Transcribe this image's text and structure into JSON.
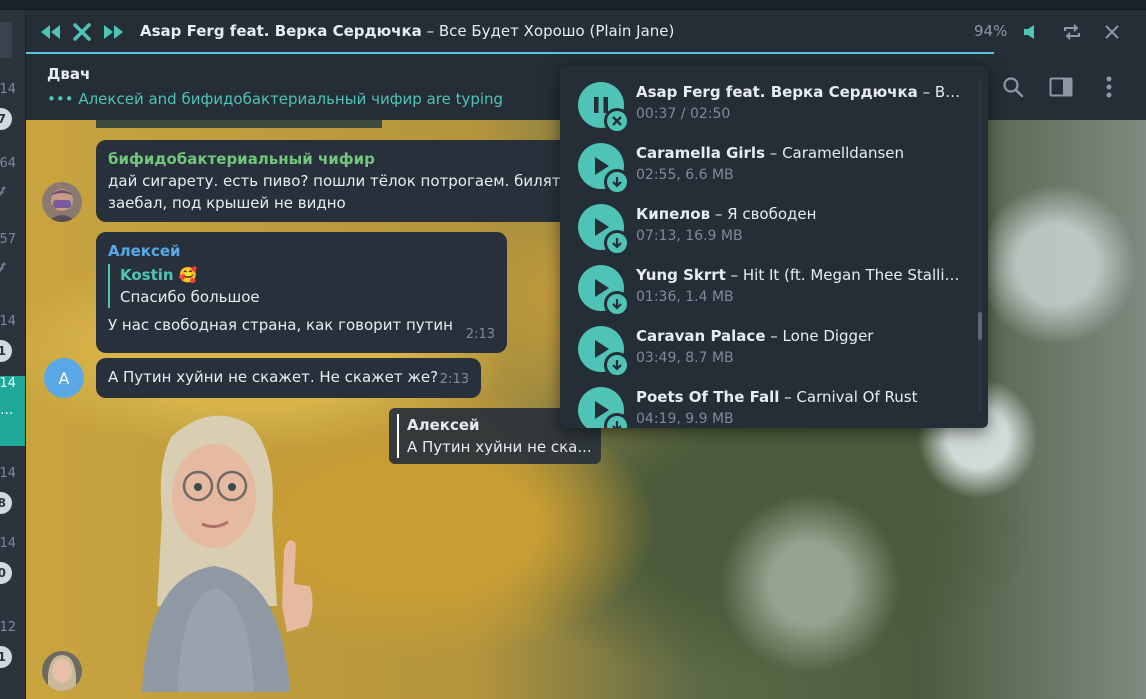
{
  "player": {
    "artist": "Asap Ferg feat. Верка Сердючка",
    "separator": " – ",
    "track": "Все Будет Хорошо (Plain Jane)",
    "volume": "94%",
    "progress_fraction": 0.927
  },
  "chat": {
    "name": "Двач",
    "typing_dots": "•••",
    "typing_text": "Алексей and бифидобактериальный чифир are typing"
  },
  "sidebar": {
    "rows": [
      {
        "time": "14",
        "badge": "7"
      },
      {
        "time": "64",
        "badge": ""
      },
      {
        "time": "57",
        "badge": ""
      },
      {
        "time": "14",
        "badge": "1"
      },
      {
        "time": "14",
        "badge": "...",
        "active": true
      },
      {
        "time": "14",
        "badge": "8"
      },
      {
        "time": "14",
        "badge": "0"
      },
      {
        "time": "12",
        "badge": "1"
      }
    ]
  },
  "messages": [
    {
      "sender": "бифидобактериальный чифир",
      "line1": "дай сигарету. есть пиво? пошли тёлок потрогаем. билять",
      "line2": "заебал, под крышей не видно"
    },
    {
      "sender": "Алексей",
      "quote_name": "Kostin 🥰",
      "quote_text": "Спасибо большое",
      "text": "У нас свободная страна, как говорит путин",
      "time": "2:13"
    },
    {
      "avatar_letter": "A",
      "text": "А Путин хуйни не скажет. Не скажет же?",
      "time": "2:13"
    }
  ],
  "reply_preview": {
    "name": "Алексей",
    "text": "А Путин хуйни не ска..."
  },
  "playlist": {
    "items": [
      {
        "artist": "Asap Ferg feat. Верка Сердючка",
        "title": "Все Будет Хорошо (Plain Jane)",
        "meta": "00:37 / 02:50",
        "playing": true
      },
      {
        "artist": "Caramella Girls",
        "title": "Caramelldansen",
        "meta": "02:55, 6.6 MB"
      },
      {
        "artist": "Кипелов",
        "title": "Я свободен",
        "meta": "07:13, 16.9 MB"
      },
      {
        "artist": "Yung Skrrt",
        "title": "Hit It (ft. Megan Thee Stallion & Quavo)",
        "meta": "01:36, 1.4 MB"
      },
      {
        "artist": "Caravan Palace",
        "title": "Lone Digger",
        "meta": "03:49, 8.7 MB"
      },
      {
        "artist": "Poets Of The Fall",
        "title": "Carnival Of Rust",
        "meta": "04:19, 9.9 MB"
      }
    ],
    "separator": " – "
  },
  "colors": {
    "accent": "#4fc3b5",
    "progress": "#5ac4da",
    "panel": "#252d36",
    "bubble": "#28313b"
  }
}
